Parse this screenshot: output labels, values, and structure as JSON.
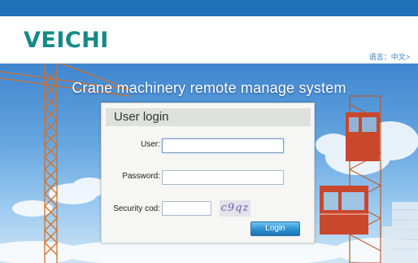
{
  "brand": {
    "logo_text": "VEICHI",
    "logo_color": "#138a86"
  },
  "header": {
    "language_label": "语言：中文>"
  },
  "hero": {
    "system_title": "Crane machinery remote manage system"
  },
  "login": {
    "title": "User login",
    "user_label": "User:",
    "user_value": "",
    "password_label": "Password:",
    "password_value": "",
    "security_label": "Security cod:",
    "security_value": "",
    "captcha_text": "c9qz",
    "login_button": "Login"
  },
  "colors": {
    "top_bar": "#1f72b8",
    "accent": "#2b8fd0"
  }
}
